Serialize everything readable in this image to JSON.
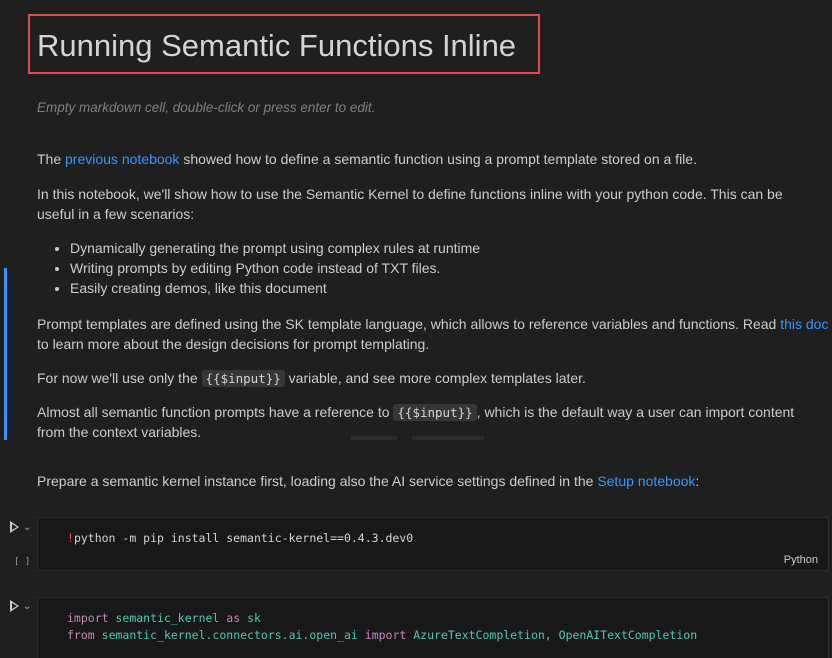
{
  "title": "Running Semantic Functions Inline",
  "placeholder": "Empty markdown cell, double-click or press enter to edit.",
  "intro": {
    "pre": "The ",
    "link": "previous notebook",
    "post": " showed how to define a semantic function using a prompt template stored on a file."
  },
  "para2_line1": "In this notebook, we'll show how to use the Semantic Kernel to define functions inline with your python code. This can be",
  "para2_line2": "useful in a few scenarios:",
  "bullets": [
    "Dynamically generating the prompt using complex rules at runtime",
    "Writing prompts by editing Python code instead of TXT files.",
    "Easily creating demos, like this document"
  ],
  "para3": {
    "pre": "Prompt templates are defined using the SK template language, which allows to reference variables and functions. Read ",
    "link": "this doc",
    "line2": "to learn more about the design decisions for prompt templating."
  },
  "para4": {
    "pre": "For now we'll use only the ",
    "code": "{{$input}}",
    "post": " variable, and see more complex templates later."
  },
  "para5": {
    "pre": "Almost all semantic function prompts have a reference to ",
    "code": "{{$input}}",
    "post": ", which is the default way a user can import content",
    "line2": "from the context variables."
  },
  "para6": {
    "pre": "Prepare a semantic kernel instance first, loading also the AI service settings defined in the ",
    "link": "Setup notebook",
    "post": ":"
  },
  "cell1": {
    "bang": "!",
    "code": "python -m pip install semantic-kernel==0.4.3.dev0",
    "exec_count": "[ ]",
    "language": "Python"
  },
  "cell2": {
    "line1_kw1": "import",
    "line1_mod": "semantic_kernel",
    "line1_kw2": "as",
    "line1_alias": "sk",
    "line2_kw1": "from",
    "line2_mod": "semantic_kernel.connectors.ai.open_ai",
    "line2_kw2": "import",
    "line2_names": "AzureTextCompletion, OpenAITextCompletion"
  },
  "colors": {
    "accent": "#3794ff",
    "highlight_border": "#e5484d",
    "keyword": "#c586c0",
    "module": "#4ec9b0"
  },
  "icons": [
    "run-cell-icon",
    "chevron-down-icon"
  ]
}
